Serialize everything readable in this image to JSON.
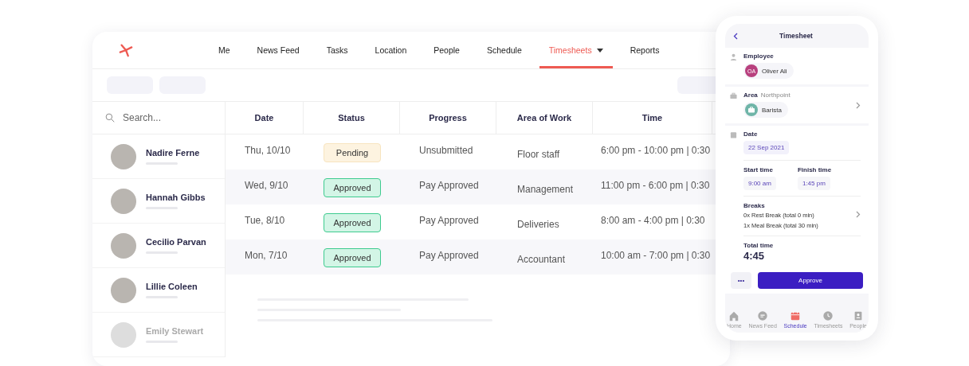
{
  "nav": {
    "items": [
      {
        "label": "Me",
        "selected": false,
        "dropdown": false
      },
      {
        "label": "News Feed",
        "selected": false,
        "dropdown": false
      },
      {
        "label": "Tasks",
        "selected": false,
        "dropdown": false
      },
      {
        "label": "Location",
        "selected": false,
        "dropdown": false
      },
      {
        "label": "People",
        "selected": false,
        "dropdown": false
      },
      {
        "label": "Schedule",
        "selected": false,
        "dropdown": false
      },
      {
        "label": "Timesheets",
        "selected": true,
        "dropdown": true
      },
      {
        "label": "Reports",
        "selected": false,
        "dropdown": false
      }
    ]
  },
  "search": {
    "placeholder": "Search..."
  },
  "people": [
    {
      "name": "Nadire Ferne",
      "dimmed": false
    },
    {
      "name": "Hannah Gibbs",
      "dimmed": false
    },
    {
      "name": "Cecilio Parvan",
      "dimmed": false
    },
    {
      "name": "Lillie Coleen",
      "dimmed": false
    },
    {
      "name": "Emily Stewart",
      "dimmed": true
    }
  ],
  "table": {
    "columns": [
      "Date",
      "Status",
      "Progress",
      "Area of Work",
      "Time"
    ],
    "rows": [
      {
        "date": "Thu, 10/10",
        "status": {
          "label": "Pending",
          "kind": "pending"
        },
        "progress": "Unsubmitted",
        "area": "Floor staff",
        "time": "6:00 pm - 10:00 pm | 0:30"
      },
      {
        "date": "Wed, 9/10",
        "status": {
          "label": "Approved",
          "kind": "approved"
        },
        "progress": "Pay Approved",
        "area": "Management",
        "time": "11:00 pm - 6:00 pm | 0:30"
      },
      {
        "date": "Tue, 8/10",
        "status": {
          "label": "Approved",
          "kind": "approved"
        },
        "progress": "Pay Approved",
        "area": "Deliveries",
        "time": "8:00 am - 4:00 pm | 0:30"
      },
      {
        "date": "Mon, 7/10",
        "status": {
          "label": "Approved",
          "kind": "approved"
        },
        "progress": "Pay Approved",
        "area": "Accountant",
        "time": "10:00 am - 7:00 pm | 0:30"
      }
    ]
  },
  "phone": {
    "title": "Timesheet",
    "employee": {
      "label": "Employee",
      "initials": "OA",
      "name": "Oliver Ali",
      "color": "#b8407e"
    },
    "area": {
      "label": "Area",
      "location": "Northpoint",
      "value": "Barista"
    },
    "date": {
      "label": "Date",
      "value": "22 Sep 2021"
    },
    "start": {
      "label": "Start time",
      "value": "9:00 am"
    },
    "finish": {
      "label": "Finish time",
      "value": "1:45 pm"
    },
    "breaks": {
      "label": "Breaks",
      "lines": [
        "0x Rest Break (total 0 min)",
        "1x Meal Break (total 30 min)"
      ]
    },
    "total": {
      "label": "Total time",
      "value": "4:45"
    },
    "more": "•••",
    "approve": "Approve",
    "tabs": [
      {
        "label": "Home",
        "selected": false
      },
      {
        "label": "News Feed",
        "selected": false
      },
      {
        "label": "Schedule",
        "selected": true
      },
      {
        "label": "Timesheets",
        "selected": false
      },
      {
        "label": "People",
        "selected": false
      }
    ]
  }
}
